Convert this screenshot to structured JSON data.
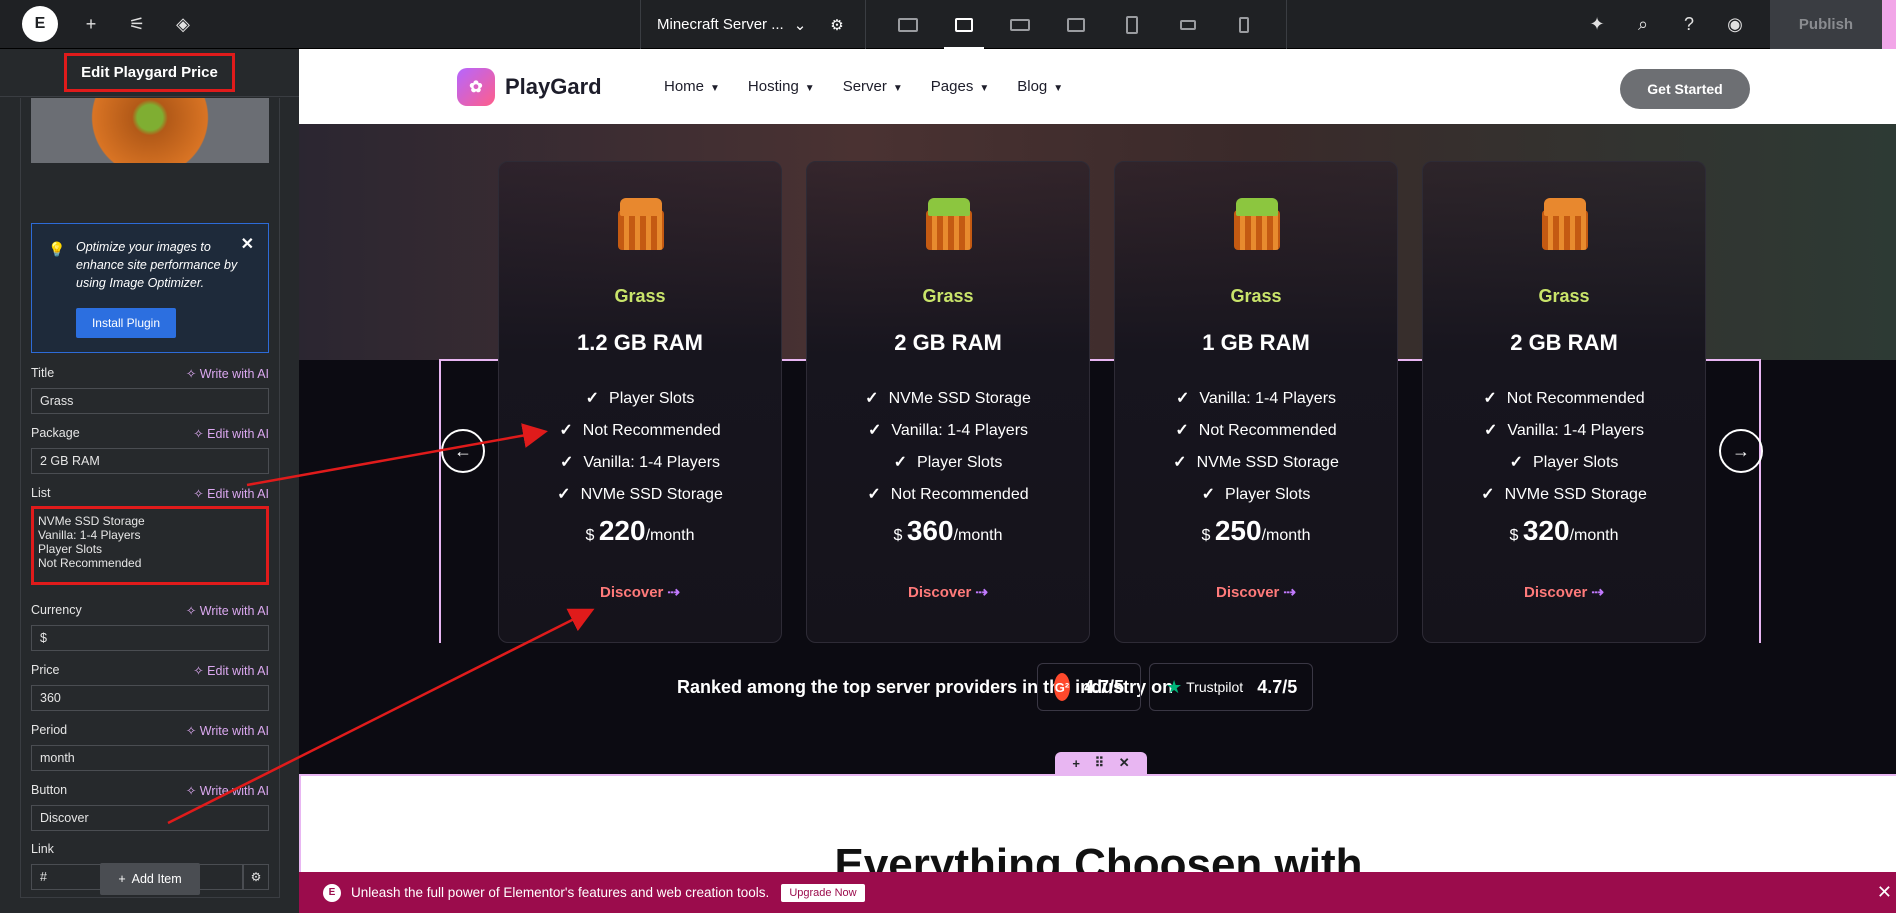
{
  "topbar": {
    "logo": "E",
    "doc_title": "Minecraft Server ...",
    "devices": [
      "desktop",
      "tablet-landscape",
      "laptop",
      "tablet-wide",
      "tablet",
      "mobile-landscape",
      "mobile"
    ],
    "publish": "Publish"
  },
  "panel": {
    "title": "Edit Playgard Price",
    "notice_text": "Optimize your images to enhance site performance by using Image Optimizer.",
    "install_label": "Install Plugin",
    "fields": {
      "title_label": "Title",
      "title_action": "Write with AI",
      "title_value": "Grass",
      "package_label": "Package",
      "package_action": "Edit with AI",
      "package_value": "2 GB RAM",
      "list_label": "List",
      "list_action": "Edit with AI",
      "list_lines": [
        "NVMe SSD Storage",
        "Vanilla: 1-4 Players",
        "Player Slots",
        "Not Recommended"
      ],
      "currency_label": "Currency",
      "currency_action": "Write with AI",
      "currency_value": "$",
      "price_label": "Price",
      "price_action": "Edit with AI",
      "price_value": "360",
      "period_label": "Period",
      "period_action": "Write with AI",
      "period_value": "month",
      "button_label": "Button",
      "button_action": "Write with AI",
      "button_value": "Discover",
      "link_label": "Link",
      "link_value": "#"
    },
    "add_item": "Add Item"
  },
  "site": {
    "brand": "PlayGard",
    "menu": [
      "Home",
      "Hosting",
      "Server",
      "Pages",
      "Blog"
    ],
    "cta": "Get Started",
    "cards": [
      {
        "title": "Grass",
        "package": "1.2 GB RAM",
        "items": [
          "Player Slots",
          "Not Recommended",
          "Vanilla: 1-4 Players",
          "NVMe SSD Storage"
        ],
        "currency": "$",
        "price": "220",
        "period": "/month",
        "button": "Discover",
        "cube": "orange"
      },
      {
        "title": "Grass",
        "package": "2 GB RAM",
        "items": [
          "NVMe SSD Storage",
          "Vanilla: 1-4 Players",
          "Player Slots",
          "Not Recommended"
        ],
        "currency": "$",
        "price": "360",
        "period": "/month",
        "button": "Discover",
        "cube": "green"
      },
      {
        "title": "Grass",
        "package": "1 GB RAM",
        "items": [
          "Vanilla: 1-4 Players",
          "Not Recommended",
          "NVMe SSD Storage",
          "Player Slots"
        ],
        "currency": "$",
        "price": "250",
        "period": "/month",
        "button": "Discover",
        "cube": "green"
      },
      {
        "title": "Grass",
        "package": "2 GB RAM",
        "items": [
          "Not Recommended",
          "Vanilla: 1-4 Players",
          "Player Slots",
          "NVMe SSD Storage"
        ],
        "currency": "$",
        "price": "320",
        "period": "/month",
        "button": "Discover",
        "cube": "orange"
      }
    ],
    "ranked": "Ranked among the top server providers in the industry on",
    "g2_rating": "4.7/5",
    "trustpilot_label": "Trustpilot",
    "trustpilot_rating": "4.7/5",
    "headline": "Everything Choosen with"
  },
  "promo": {
    "text": "Unleash the full power of Elementor's features and web creation tools.",
    "upgrade": "Upgrade Now"
  },
  "colors": {
    "accent_pink": "#e8b6f2",
    "annotation_red": "#e01b1b",
    "grass_title": "#c9e46a",
    "discover": "#ff7a7a"
  }
}
